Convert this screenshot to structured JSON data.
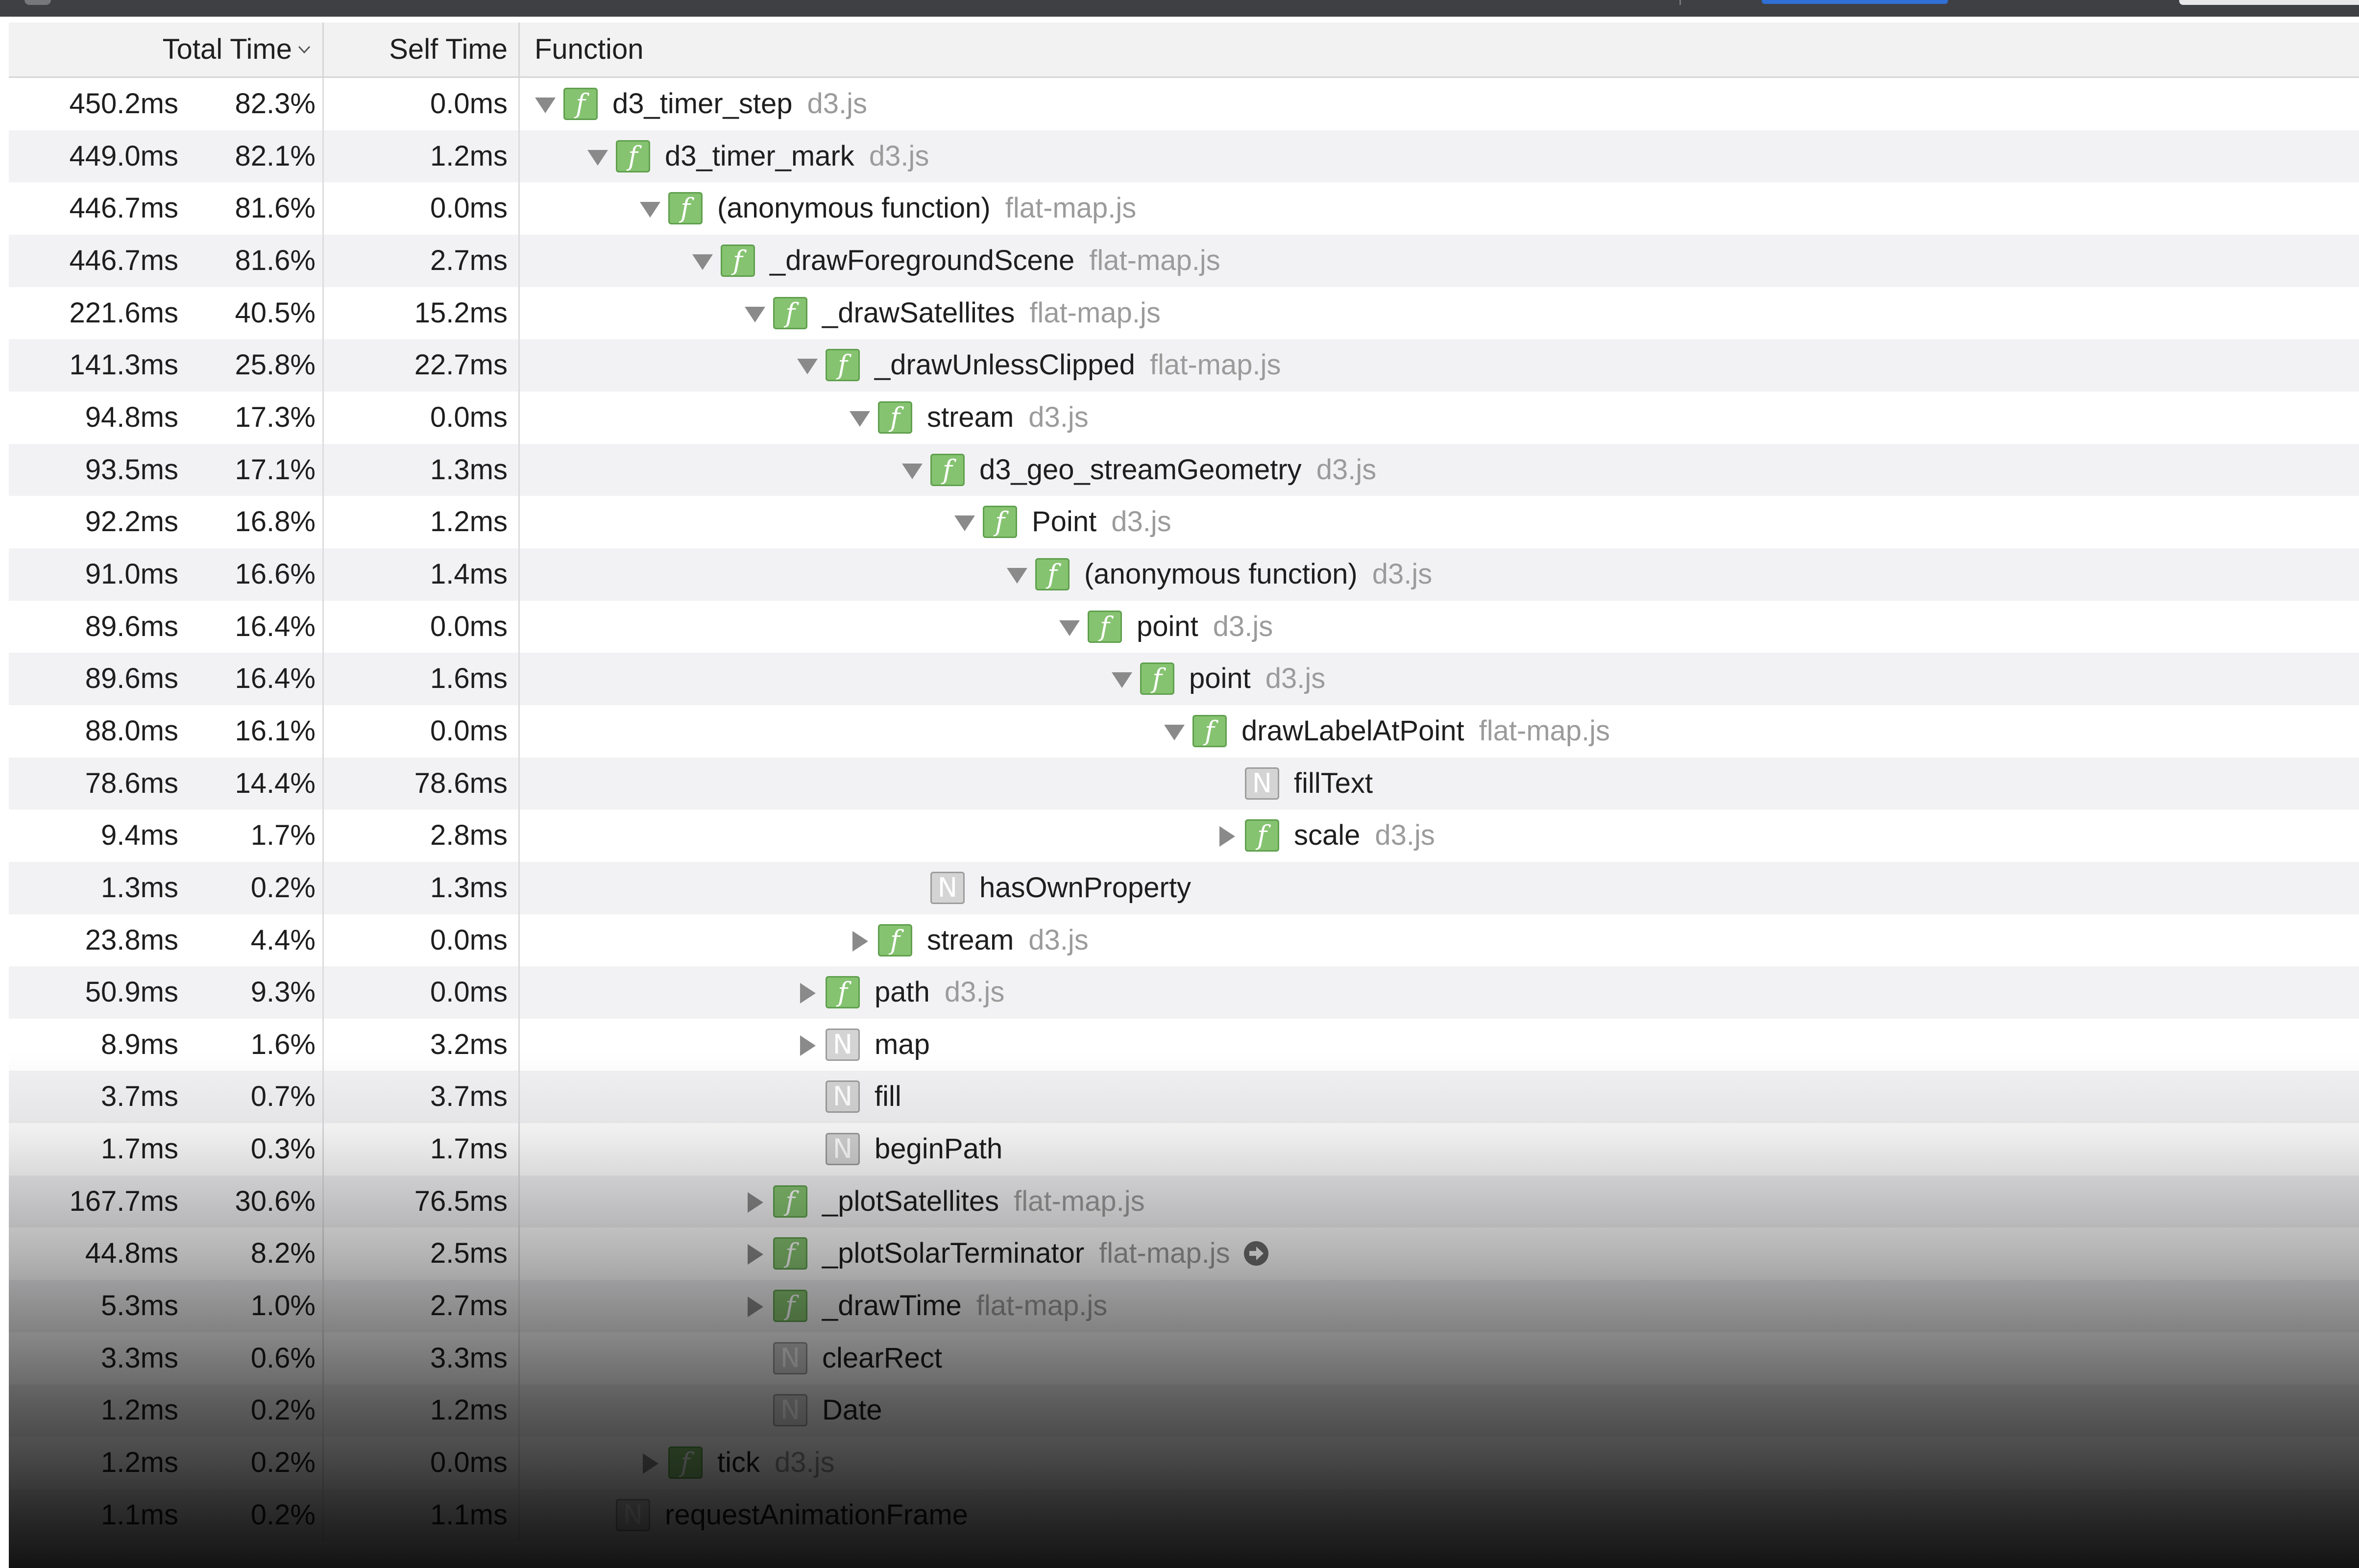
{
  "header": {
    "total_time": "Total Time",
    "self_time": "Self Time",
    "function": "Function",
    "sort_icon": "chevron-down-icon"
  },
  "rows": [
    {
      "total_ms": "450.2ms",
      "percent": "82.3%",
      "self_ms": "0.0ms",
      "depth": 0,
      "expand": "expanded",
      "kind": "f",
      "name": "d3_timer_step",
      "location": "d3.js"
    },
    {
      "total_ms": "449.0ms",
      "percent": "82.1%",
      "self_ms": "1.2ms",
      "depth": 1,
      "expand": "expanded",
      "kind": "f",
      "name": "d3_timer_mark",
      "location": "d3.js"
    },
    {
      "total_ms": "446.7ms",
      "percent": "81.6%",
      "self_ms": "0.0ms",
      "depth": 2,
      "expand": "expanded",
      "kind": "f",
      "name": "(anonymous function)",
      "location": "flat-map.js"
    },
    {
      "total_ms": "446.7ms",
      "percent": "81.6%",
      "self_ms": "2.7ms",
      "depth": 3,
      "expand": "expanded",
      "kind": "f",
      "name": "_drawForegroundScene",
      "location": "flat-map.js"
    },
    {
      "total_ms": "221.6ms",
      "percent": "40.5%",
      "self_ms": "15.2ms",
      "depth": 4,
      "expand": "expanded",
      "kind": "f",
      "name": "_drawSatellites",
      "location": "flat-map.js"
    },
    {
      "total_ms": "141.3ms",
      "percent": "25.8%",
      "self_ms": "22.7ms",
      "depth": 5,
      "expand": "expanded",
      "kind": "f",
      "name": "_drawUnlessClipped",
      "location": "flat-map.js"
    },
    {
      "total_ms": "94.8ms",
      "percent": "17.3%",
      "self_ms": "0.0ms",
      "depth": 6,
      "expand": "expanded",
      "kind": "f",
      "name": "stream",
      "location": "d3.js"
    },
    {
      "total_ms": "93.5ms",
      "percent": "17.1%",
      "self_ms": "1.3ms",
      "depth": 7,
      "expand": "expanded",
      "kind": "f",
      "name": "d3_geo_streamGeometry",
      "location": "d3.js"
    },
    {
      "total_ms": "92.2ms",
      "percent": "16.8%",
      "self_ms": "1.2ms",
      "depth": 8,
      "expand": "expanded",
      "kind": "f",
      "name": "Point",
      "location": "d3.js"
    },
    {
      "total_ms": "91.0ms",
      "percent": "16.6%",
      "self_ms": "1.4ms",
      "depth": 9,
      "expand": "expanded",
      "kind": "f",
      "name": "(anonymous function)",
      "location": "d3.js"
    },
    {
      "total_ms": "89.6ms",
      "percent": "16.4%",
      "self_ms": "0.0ms",
      "depth": 10,
      "expand": "expanded",
      "kind": "f",
      "name": "point",
      "location": "d3.js"
    },
    {
      "total_ms": "89.6ms",
      "percent": "16.4%",
      "self_ms": "1.6ms",
      "depth": 11,
      "expand": "expanded",
      "kind": "f",
      "name": "point",
      "location": "d3.js"
    },
    {
      "total_ms": "88.0ms",
      "percent": "16.1%",
      "self_ms": "0.0ms",
      "depth": 12,
      "expand": "expanded",
      "kind": "f",
      "name": "drawLabelAtPoint",
      "location": "flat-map.js"
    },
    {
      "total_ms": "78.6ms",
      "percent": "14.4%",
      "self_ms": "78.6ms",
      "depth": 13,
      "expand": "none",
      "kind": "n",
      "name": "fillText",
      "location": ""
    },
    {
      "total_ms": "9.4ms",
      "percent": "1.7%",
      "self_ms": "2.8ms",
      "depth": 13,
      "expand": "collapsed",
      "kind": "f",
      "name": "scale",
      "location": "d3.js"
    },
    {
      "total_ms": "1.3ms",
      "percent": "0.2%",
      "self_ms": "1.3ms",
      "depth": 7,
      "expand": "none",
      "kind": "n",
      "name": "hasOwnProperty",
      "location": ""
    },
    {
      "total_ms": "23.8ms",
      "percent": "4.4%",
      "self_ms": "0.0ms",
      "depth": 6,
      "expand": "collapsed",
      "kind": "f",
      "name": "stream",
      "location": "d3.js"
    },
    {
      "total_ms": "50.9ms",
      "percent": "9.3%",
      "self_ms": "0.0ms",
      "depth": 5,
      "expand": "collapsed",
      "kind": "f",
      "name": "path",
      "location": "d3.js"
    },
    {
      "total_ms": "8.9ms",
      "percent": "1.6%",
      "self_ms": "3.2ms",
      "depth": 5,
      "expand": "collapsed",
      "kind": "n",
      "name": "map",
      "location": ""
    },
    {
      "total_ms": "3.7ms",
      "percent": "0.7%",
      "self_ms": "3.7ms",
      "depth": 5,
      "expand": "none",
      "kind": "n",
      "name": "fill",
      "location": ""
    },
    {
      "total_ms": "1.7ms",
      "percent": "0.3%",
      "self_ms": "1.7ms",
      "depth": 5,
      "expand": "none",
      "kind": "n",
      "name": "beginPath",
      "location": ""
    },
    {
      "total_ms": "167.7ms",
      "percent": "30.6%",
      "self_ms": "76.5ms",
      "depth": 4,
      "expand": "collapsed",
      "kind": "f",
      "name": "_plotSatellites",
      "location": "flat-map.js"
    },
    {
      "total_ms": "44.8ms",
      "percent": "8.2%",
      "self_ms": "2.5ms",
      "depth": 4,
      "expand": "collapsed",
      "kind": "f",
      "name": "_plotSolarTerminator",
      "location": "flat-map.js",
      "goto": true
    },
    {
      "total_ms": "5.3ms",
      "percent": "1.0%",
      "self_ms": "2.7ms",
      "depth": 4,
      "expand": "collapsed",
      "kind": "f",
      "name": "_drawTime",
      "location": "flat-map.js"
    },
    {
      "total_ms": "3.3ms",
      "percent": "0.6%",
      "self_ms": "3.3ms",
      "depth": 4,
      "expand": "none",
      "kind": "n",
      "name": "clearRect",
      "location": ""
    },
    {
      "total_ms": "1.2ms",
      "percent": "0.2%",
      "self_ms": "1.2ms",
      "depth": 4,
      "expand": "none",
      "kind": "n",
      "name": "Date",
      "location": ""
    },
    {
      "total_ms": "1.2ms",
      "percent": "0.2%",
      "self_ms": "0.0ms",
      "depth": 2,
      "expand": "collapsed",
      "kind": "f",
      "name": "tick",
      "location": "d3.js"
    },
    {
      "total_ms": "1.1ms",
      "percent": "0.2%",
      "self_ms": "1.1ms",
      "depth": 1,
      "expand": "none",
      "kind": "n",
      "name": "requestAnimationFrame",
      "location": ""
    }
  ],
  "colors": {
    "function_badge": "#86c371",
    "native_badge": "#d4d4d4",
    "location_text": "#9b9b9b",
    "row_alt": "#f2f2f4",
    "header_bg": "#f2f2f3"
  }
}
